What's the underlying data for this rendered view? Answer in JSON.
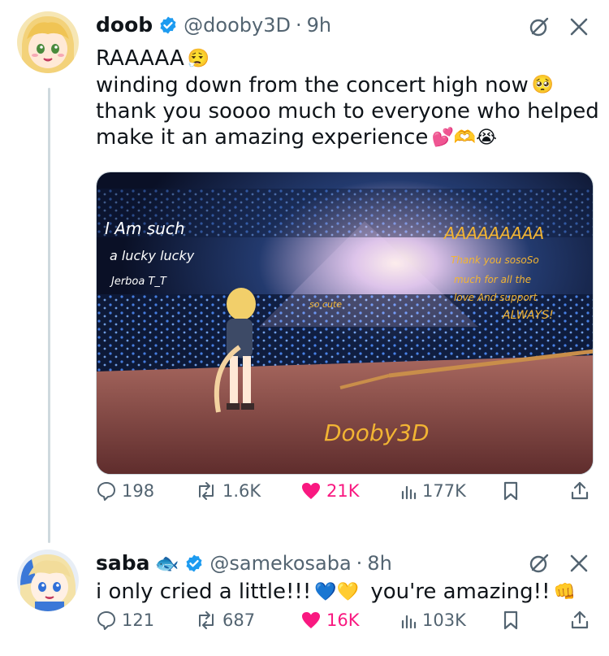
{
  "posts": [
    {
      "display_name": "doob",
      "handle": "@dooby3D",
      "separator": "·",
      "time": "9h",
      "lines": [
        {
          "text": "RAAAAA",
          "emoji": "😮‍💨"
        },
        {
          "text": "winding down from the concert high now",
          "emoji": "🥺"
        },
        {
          "text": "thank you soooo much to everyone who helped",
          "emoji": ""
        },
        {
          "text": "make it an amazing experience",
          "emoji": "💕🫶😭"
        }
      ],
      "image_captions": {
        "left": [
          "I Am such",
          "a lucky lucky",
          "Jerboa T_T"
        ],
        "right_title": "AAAAAAAAA",
        "right": [
          "Thank you sosoSo",
          "much for all the",
          "love And support",
          "ALWAYS!"
        ],
        "center": "so cute",
        "signature": "Dooby3D"
      },
      "stats": {
        "replies": "198",
        "reposts": "1.6K",
        "likes": "21K",
        "views": "177K"
      }
    },
    {
      "display_name": "saba",
      "name_emoji": "🐟",
      "handle": "@samekosaba",
      "separator": "·",
      "time": "8h",
      "lines": [
        {
          "text": "i only cried a little!!!",
          "emoji": "💙💛"
        },
        {
          "text": "you're amazing!!",
          "emoji": "👊"
        }
      ],
      "stats": {
        "replies": "121",
        "reposts": "687",
        "likes": "16K",
        "views": "103K"
      }
    }
  ],
  "colors": {
    "verified": "#1d9bf0",
    "like": "#f91880",
    "secondary_text": "#536471"
  },
  "icons": [
    "verified-icon",
    "grok-icon",
    "close-icon",
    "reply-icon",
    "repost-icon",
    "like-icon",
    "views-icon",
    "bookmark-icon",
    "share-icon"
  ]
}
